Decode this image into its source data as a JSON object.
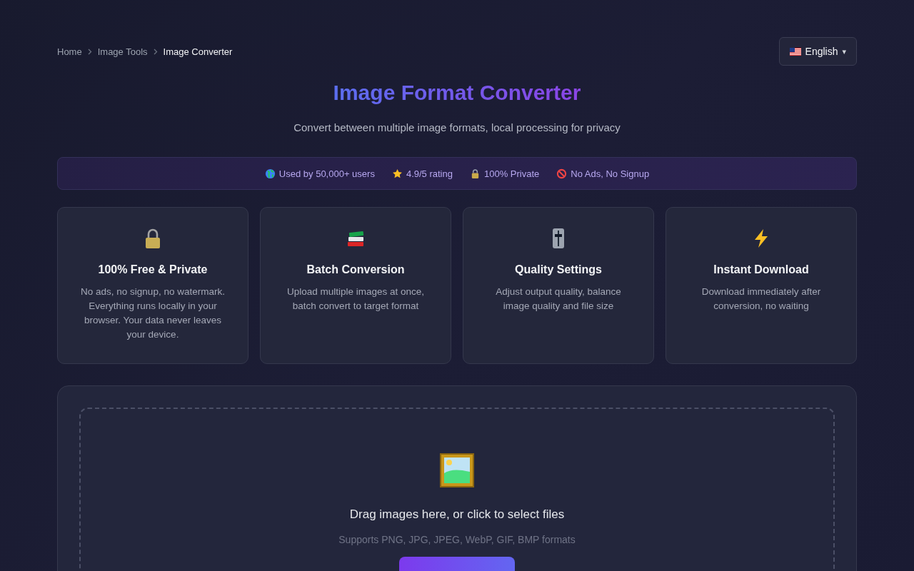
{
  "breadcrumb": [
    {
      "label": "Home",
      "current": false
    },
    {
      "label": "Image Tools",
      "current": false
    },
    {
      "label": "Image Converter",
      "current": true
    }
  ],
  "language": {
    "label": "English",
    "caret": "▾"
  },
  "title": "Image Format Converter",
  "subtitle": "Convert between multiple image formats, local processing for privacy",
  "stats": [
    "Used by 50,000+ users",
    "4.9/5 rating",
    "100% Private",
    "No Ads, No Signup"
  ],
  "features": [
    {
      "title": "100% Free & Private",
      "text": "No ads, no signup, no watermark. Everything runs locally in your browser. Your data never leaves your device."
    },
    {
      "title": "Batch Conversion",
      "text": "Upload multiple images at once, batch convert to target format"
    },
    {
      "title": "Quality Settings",
      "text": "Adjust output quality, balance image quality and file size"
    },
    {
      "title": "Instant Download",
      "text": "Download immediately after conversion, no waiting"
    }
  ],
  "upload": {
    "prompt": "Drag images here, or click to select files",
    "hint": "Supports PNG, JPG, JPEG, WebP, GIF, BMP formats"
  }
}
